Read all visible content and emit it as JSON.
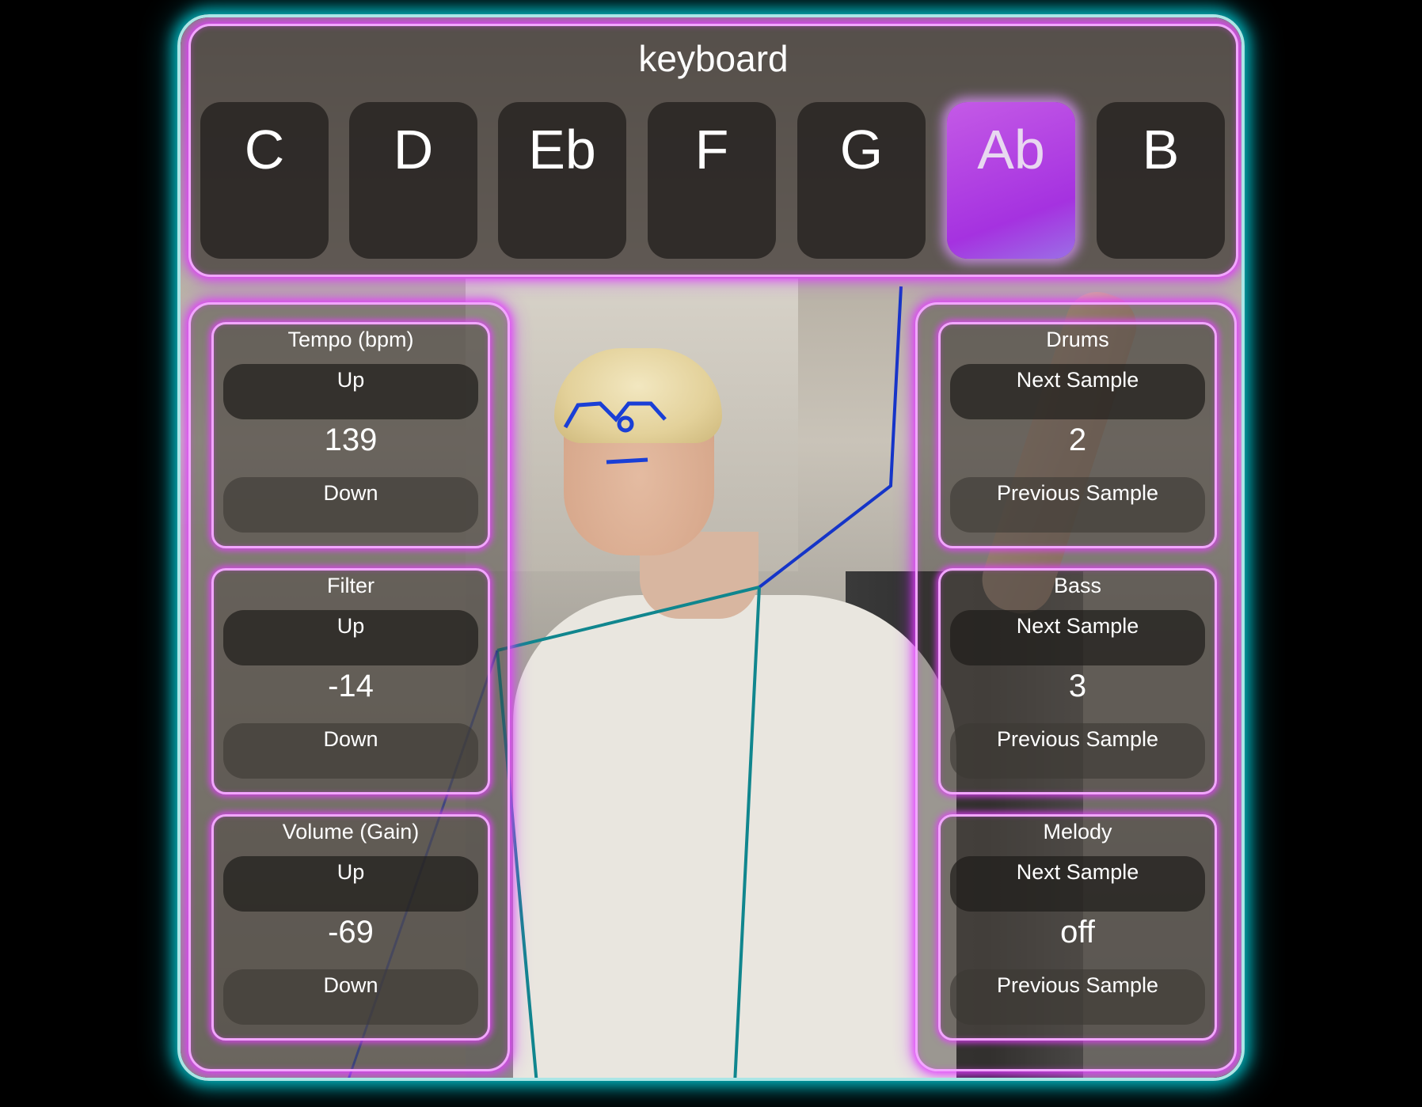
{
  "keyboard": {
    "title": "keyboard",
    "keys": [
      "C",
      "D",
      "Eb",
      "F",
      "G",
      "Ab",
      "B"
    ],
    "active_key": "Ab"
  },
  "left_controls": [
    {
      "title": "Tempo (bpm)",
      "up": "Up",
      "value": "139",
      "down": "Down"
    },
    {
      "title": "Filter",
      "up": "Up",
      "value": "-14",
      "down": "Down"
    },
    {
      "title": "Volume (Gain)",
      "up": "Up",
      "value": "-69",
      "down": "Down"
    }
  ],
  "right_controls": [
    {
      "title": "Drums",
      "up": "Next Sample",
      "value": "2",
      "down": "Previous Sample"
    },
    {
      "title": "Bass",
      "up": "Next Sample",
      "value": "3",
      "down": "Previous Sample"
    },
    {
      "title": "Melody",
      "up": "Next Sample",
      "value": "off",
      "down": "Previous Sample"
    }
  ],
  "colors": {
    "neon_pink": "#e63cff",
    "neon_cyan": "#00dce6",
    "active_key": "#a532e0",
    "pose_face": "#1a3fd6",
    "pose_body": "#10868e"
  }
}
